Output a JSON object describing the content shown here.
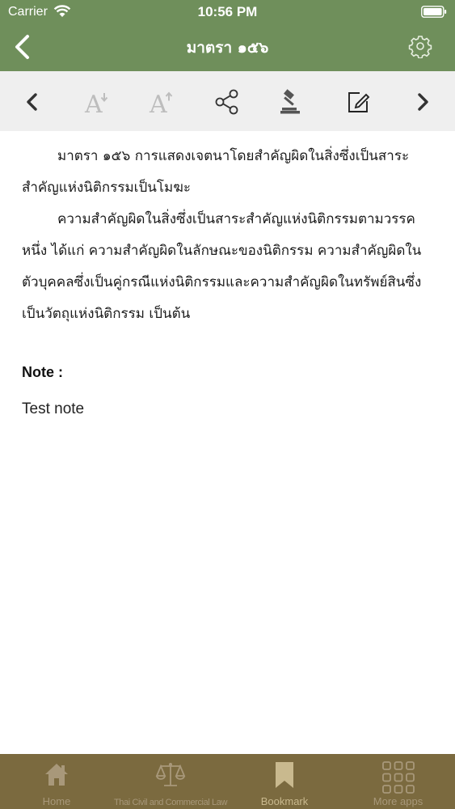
{
  "status_bar": {
    "carrier": "Carrier",
    "time": "10:56 PM",
    "icons": [
      "wifi-icon",
      "battery-icon"
    ]
  },
  "nav": {
    "title": "มาตรา ๑๕๖",
    "back_icon": "chevron-left-icon",
    "settings_icon": "gear-icon"
  },
  "toolbar": {
    "items": [
      {
        "icon": "chevron-left-icon",
        "action": "previous-section"
      },
      {
        "icon": "font-decrease-icon",
        "action": "decrease-font"
      },
      {
        "icon": "font-increase-icon",
        "action": "increase-font"
      },
      {
        "icon": "share-icon",
        "action": "share"
      },
      {
        "icon": "gavel-icon",
        "action": "rulings"
      },
      {
        "icon": "edit-note-icon",
        "action": "edit-note"
      },
      {
        "icon": "chevron-right-icon",
        "action": "next-section"
      }
    ]
  },
  "content": {
    "paragraph_1": "มาตรา ๑๕๖  การแสดงเจตนาโดยสำคัญผิดในสิ่งซึ่งเป็นสาระสำคัญแห่งนิติกรรมเป็นโมฆะ",
    "paragraph_2": "ความสำคัญผิดในสิ่งซึ่งเป็นสาระสำคัญแห่งนิติกรรมตามวรรคหนึ่ง ได้แก่ ความสำคัญผิดในลักษณะของนิติกรรม  ความสำคัญผิดในตัวบุคคลซึ่งเป็นคู่กรณีแห่งนิติกรรมและความสำคัญผิดในทรัพย์สินซึ่งเป็นวัตถุแห่งนิติกรรม เป็นต้น"
  },
  "note": {
    "label": "Note :",
    "text": "Test note"
  },
  "tab_bar": {
    "tabs": [
      {
        "label": "Home",
        "icon": "home-icon",
        "active": false
      },
      {
        "label": "Thai Civil and Commercial Law",
        "icon": "scales-icon",
        "active": false
      },
      {
        "label": "Bookmark",
        "icon": "bookmark-icon",
        "active": true
      },
      {
        "label": "More apps",
        "icon": "grid-icon",
        "active": false
      }
    ]
  },
  "colors": {
    "header_green": "#6f8f5b",
    "toolbar_gray": "#efefef",
    "tab_bar_brown": "#7b6a3f",
    "tab_icon": "#a8987a",
    "tab_active": "#c9b98e"
  }
}
